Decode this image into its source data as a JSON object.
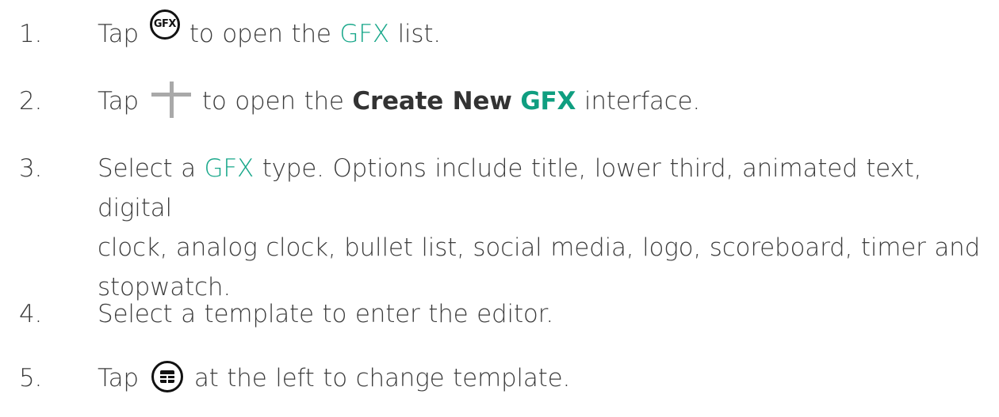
{
  "steps": [
    {
      "number": "1.",
      "before_icon": "Tap",
      "icon": "gfx-icon",
      "icon_text": "GFX",
      "after_icon": "to open the",
      "accent": "GFX",
      "tail": "list."
    },
    {
      "number": "2.",
      "before_icon": "Tap",
      "icon": "plus-icon",
      "after_icon": "to open the",
      "bold": "Create New",
      "accent": "GFX",
      "tail": "interface."
    },
    {
      "number": "3.",
      "before_accent": "Select a",
      "accent": "GFX",
      "line1_tail": "type. Options include title, lower third, animated text, digital",
      "line2": "clock, analog clock, bullet list, social media, logo, scoreboard, timer and",
      "line3": "stopwatch."
    },
    {
      "number": "4.",
      "text": "Select a template to enter the editor."
    },
    {
      "number": "5.",
      "before_icon": "Tap",
      "icon": "template-icon",
      "after_icon": "at the left to change template."
    }
  ],
  "colors": {
    "text": "#3c3c3c",
    "accent": "#18a78a",
    "icon_gray": "#a9a9a9",
    "icon_black": "#111111"
  }
}
